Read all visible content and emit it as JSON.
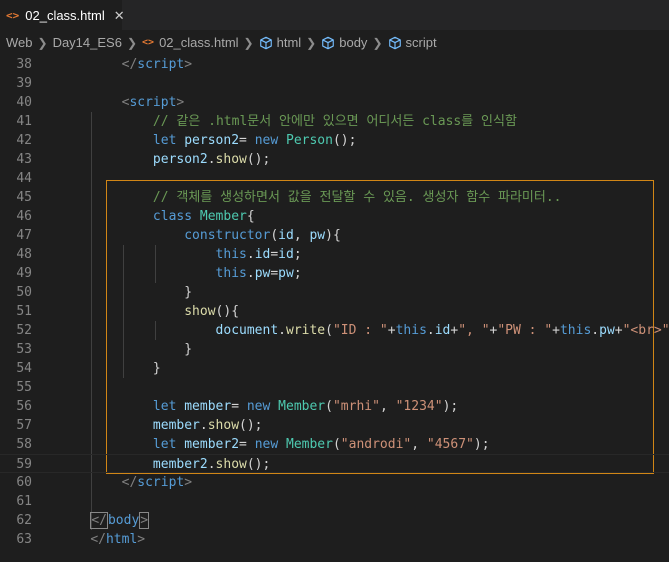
{
  "tab": {
    "icon": "<>",
    "label": "02_class.html",
    "close": "✕"
  },
  "breadcrumb": {
    "items": [
      "Web",
      "Day14_ES6",
      "02_class.html",
      "html",
      "body",
      "script"
    ]
  },
  "lines": [
    {
      "n": "38",
      "t": [
        [
          "        ",
          "pl"
        ],
        [
          "</",
          "tag"
        ],
        [
          "script",
          "tn"
        ],
        [
          ">",
          "tag"
        ]
      ]
    },
    {
      "n": "39",
      "t": []
    },
    {
      "n": "40",
      "t": [
        [
          "        ",
          "pl"
        ],
        [
          "<",
          "tag"
        ],
        [
          "script",
          "tn"
        ],
        [
          ">",
          "tag"
        ]
      ]
    },
    {
      "n": "41",
      "t": [
        [
          "            ",
          "pl"
        ],
        [
          "// 같은 .html문서 안에만 있으면 어디서든 class를 인식함",
          "cm"
        ]
      ]
    },
    {
      "n": "42",
      "t": [
        [
          "            ",
          "pl"
        ],
        [
          "let",
          "kw"
        ],
        [
          " ",
          "pl"
        ],
        [
          "person2",
          "vr"
        ],
        [
          "= ",
          "pl"
        ],
        [
          "new",
          "kw"
        ],
        [
          " ",
          "pl"
        ],
        [
          "Person",
          "cls"
        ],
        [
          "();",
          "pl"
        ]
      ]
    },
    {
      "n": "43",
      "t": [
        [
          "            ",
          "pl"
        ],
        [
          "person2",
          "vr"
        ],
        [
          ".",
          "pl"
        ],
        [
          "show",
          "fn"
        ],
        [
          "();",
          "pl"
        ]
      ]
    },
    {
      "n": "44",
      "t": []
    },
    {
      "n": "45",
      "t": [
        [
          "            ",
          "pl"
        ],
        [
          "// 객체를 생성하면서 값을 전달할 수 있음. 생성자 함수 파라미터..",
          "cm"
        ]
      ]
    },
    {
      "n": "46",
      "t": [
        [
          "            ",
          "pl"
        ],
        [
          "class",
          "kw"
        ],
        [
          " ",
          "pl"
        ],
        [
          "Member",
          "cls"
        ],
        [
          "{",
          "pl"
        ]
      ]
    },
    {
      "n": "47",
      "t": [
        [
          "                ",
          "pl"
        ],
        [
          "constructor",
          "kw"
        ],
        [
          "(",
          "pl"
        ],
        [
          "id",
          "vr"
        ],
        [
          ", ",
          "pl"
        ],
        [
          "pw",
          "vr"
        ],
        [
          "){",
          "pl"
        ]
      ]
    },
    {
      "n": "48",
      "t": [
        [
          "                    ",
          "pl"
        ],
        [
          "this",
          "kw"
        ],
        [
          ".",
          "pl"
        ],
        [
          "id",
          "vr"
        ],
        [
          "=",
          "pl"
        ],
        [
          "id",
          "vr"
        ],
        [
          ";",
          "pl"
        ]
      ]
    },
    {
      "n": "49",
      "t": [
        [
          "                    ",
          "pl"
        ],
        [
          "this",
          "kw"
        ],
        [
          ".",
          "pl"
        ],
        [
          "pw",
          "vr"
        ],
        [
          "=",
          "pl"
        ],
        [
          "pw",
          "vr"
        ],
        [
          ";",
          "pl"
        ]
      ]
    },
    {
      "n": "50",
      "t": [
        [
          "                ",
          "pl"
        ],
        [
          "}",
          "pl"
        ]
      ]
    },
    {
      "n": "51",
      "t": [
        [
          "                ",
          "pl"
        ],
        [
          "show",
          "fn"
        ],
        [
          "(){",
          "pl"
        ]
      ]
    },
    {
      "n": "52",
      "t": [
        [
          "                    ",
          "pl"
        ],
        [
          "document",
          "vr"
        ],
        [
          ".",
          "pl"
        ],
        [
          "write",
          "fn"
        ],
        [
          "(",
          "pl"
        ],
        [
          "\"ID : \"",
          "st"
        ],
        [
          "+",
          "pl"
        ],
        [
          "this",
          "kw"
        ],
        [
          ".",
          "pl"
        ],
        [
          "id",
          "vr"
        ],
        [
          "+",
          "pl"
        ],
        [
          "\", \"",
          "st"
        ],
        [
          "+",
          "pl"
        ],
        [
          "\"PW : \"",
          "st"
        ],
        [
          "+",
          "pl"
        ],
        [
          "this",
          "kw"
        ],
        [
          ".",
          "pl"
        ],
        [
          "pw",
          "vr"
        ],
        [
          "+",
          "pl"
        ],
        [
          "\"<br>\"",
          "st"
        ],
        [
          ");",
          "pl"
        ]
      ]
    },
    {
      "n": "53",
      "t": [
        [
          "                ",
          "pl"
        ],
        [
          "}",
          "pl"
        ]
      ]
    },
    {
      "n": "54",
      "t": [
        [
          "            ",
          "pl"
        ],
        [
          "}",
          "pl"
        ]
      ]
    },
    {
      "n": "55",
      "t": []
    },
    {
      "n": "56",
      "t": [
        [
          "            ",
          "pl"
        ],
        [
          "let",
          "kw"
        ],
        [
          " ",
          "pl"
        ],
        [
          "member",
          "vr"
        ],
        [
          "= ",
          "pl"
        ],
        [
          "new",
          "kw"
        ],
        [
          " ",
          "pl"
        ],
        [
          "Member",
          "cls"
        ],
        [
          "(",
          "pl"
        ],
        [
          "\"mrhi\"",
          "st"
        ],
        [
          ", ",
          "pl"
        ],
        [
          "\"1234\"",
          "st"
        ],
        [
          ");",
          "pl"
        ]
      ]
    },
    {
      "n": "57",
      "t": [
        [
          "            ",
          "pl"
        ],
        [
          "member",
          "vr"
        ],
        [
          ".",
          "pl"
        ],
        [
          "show",
          "fn"
        ],
        [
          "();",
          "pl"
        ]
      ]
    },
    {
      "n": "58",
      "t": [
        [
          "            ",
          "pl"
        ],
        [
          "let",
          "kw"
        ],
        [
          " ",
          "pl"
        ],
        [
          "member2",
          "vr"
        ],
        [
          "= ",
          "pl"
        ],
        [
          "new",
          "kw"
        ],
        [
          " ",
          "pl"
        ],
        [
          "Member",
          "cls"
        ],
        [
          "(",
          "pl"
        ],
        [
          "\"androdi\"",
          "st"
        ],
        [
          ", ",
          "pl"
        ],
        [
          "\"4567\"",
          "st"
        ],
        [
          ");",
          "pl"
        ]
      ]
    },
    {
      "n": "59",
      "t": [
        [
          "            ",
          "pl"
        ],
        [
          "member2",
          "vr"
        ],
        [
          ".",
          "pl"
        ],
        [
          "show",
          "fn"
        ],
        [
          "();",
          "pl"
        ]
      ]
    },
    {
      "n": "60",
      "t": [
        [
          "        ",
          "pl"
        ],
        [
          "</",
          "tag"
        ],
        [
          "script",
          "tn"
        ],
        [
          ">",
          "tag"
        ]
      ]
    },
    {
      "n": "61",
      "t": []
    },
    {
      "n": "62",
      "t": [
        [
          "    ",
          "pl"
        ],
        [
          "</",
          "tag"
        ],
        [
          "body",
          "tn"
        ],
        [
          ">",
          "tag"
        ]
      ]
    },
    {
      "n": "63",
      "t": [
        [
          "    ",
          "pl"
        ],
        [
          "</",
          "tag"
        ],
        [
          "html",
          "tn"
        ],
        [
          ">",
          "tag"
        ]
      ]
    }
  ]
}
